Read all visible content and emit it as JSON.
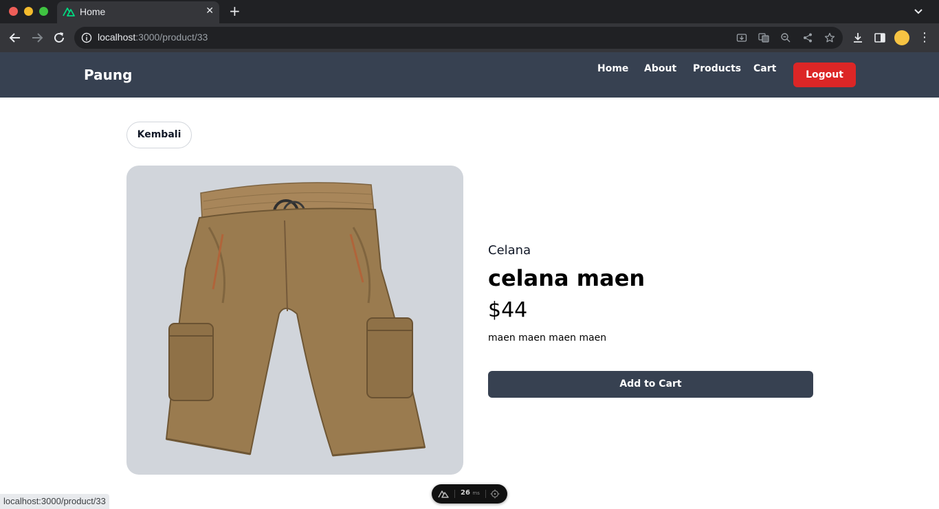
{
  "browser": {
    "tab_title": "Home",
    "url_host": "localhost",
    "url_path": ":3000/product/33",
    "status_url": "localhost:3000/product/33"
  },
  "header": {
    "brand": "Paung",
    "nav": [
      "Home",
      "About",
      "Products",
      "Cart"
    ],
    "logout_label": "Logout"
  },
  "product": {
    "back_label": "Kembali",
    "category": "Celana",
    "name": "celana maen",
    "price": "$44",
    "description": "maen maen maen maen",
    "add_to_cart_label": "Add to Cart",
    "image_alt": "brown cargo shorts with belt"
  },
  "devtools": {
    "time_value": "26",
    "time_unit": "ms"
  },
  "colors": {
    "header_bg": "#374151",
    "logout_bg": "#dc2626",
    "image_card_bg": "#d1d5db",
    "add_to_cart_bg": "#374151"
  }
}
